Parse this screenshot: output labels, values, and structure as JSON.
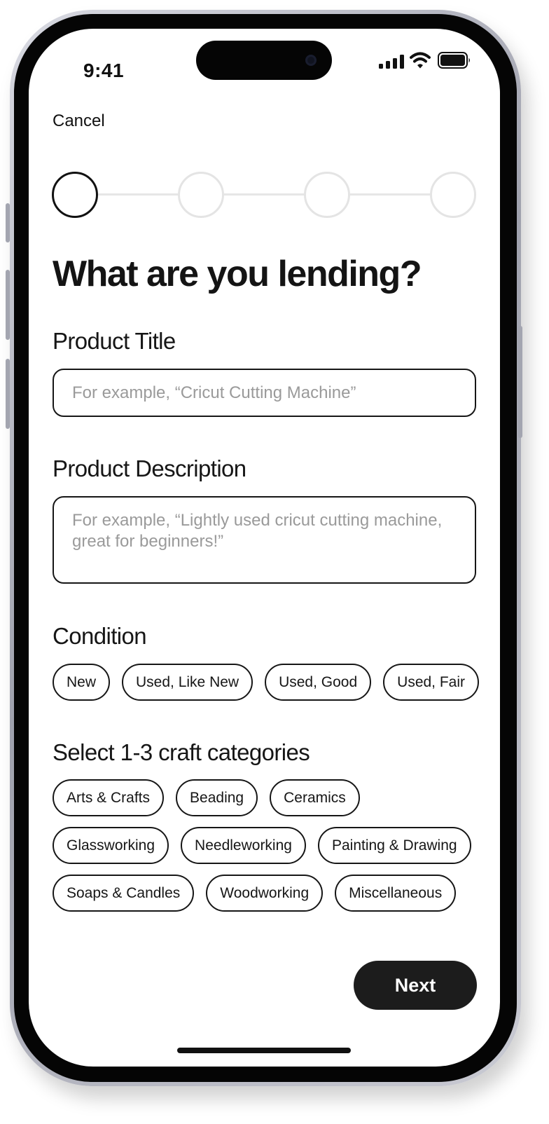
{
  "status_bar": {
    "time": "9:41"
  },
  "header": {
    "cancel_label": "Cancel"
  },
  "stepper": {
    "total_steps": 4,
    "current_step": 1
  },
  "page": {
    "title": "What are you lending?"
  },
  "product_title": {
    "label": "Product Title",
    "value": "",
    "placeholder": "For example, “Cricut Cutting Machine”"
  },
  "product_description": {
    "label": "Product Description",
    "value": "",
    "placeholder": "For example, “Lightly used cricut cutting machine, great for beginners!”"
  },
  "condition": {
    "label": "Condition",
    "options": [
      "New",
      "Used, Like New",
      "Used, Good",
      "Used, Fair"
    ]
  },
  "categories": {
    "label": "Select 1-3 craft categories",
    "options": [
      "Arts & Crafts",
      "Beading",
      "Ceramics",
      "Glassworking",
      "Needleworking",
      "Painting & Drawing",
      "Soaps & Candles",
      "Woodworking",
      "Miscellaneous"
    ]
  },
  "footer": {
    "next_label": "Next"
  },
  "icons": {
    "signal": "cellular-signal-icon",
    "wifi": "wifi-icon",
    "battery": "battery-icon"
  },
  "colors": {
    "text": "#161616",
    "button_background": "#1c1c1c",
    "button_text": "#ffffff",
    "placeholder": "#9a9a9a",
    "inactive_step": "#e4e4e4"
  }
}
